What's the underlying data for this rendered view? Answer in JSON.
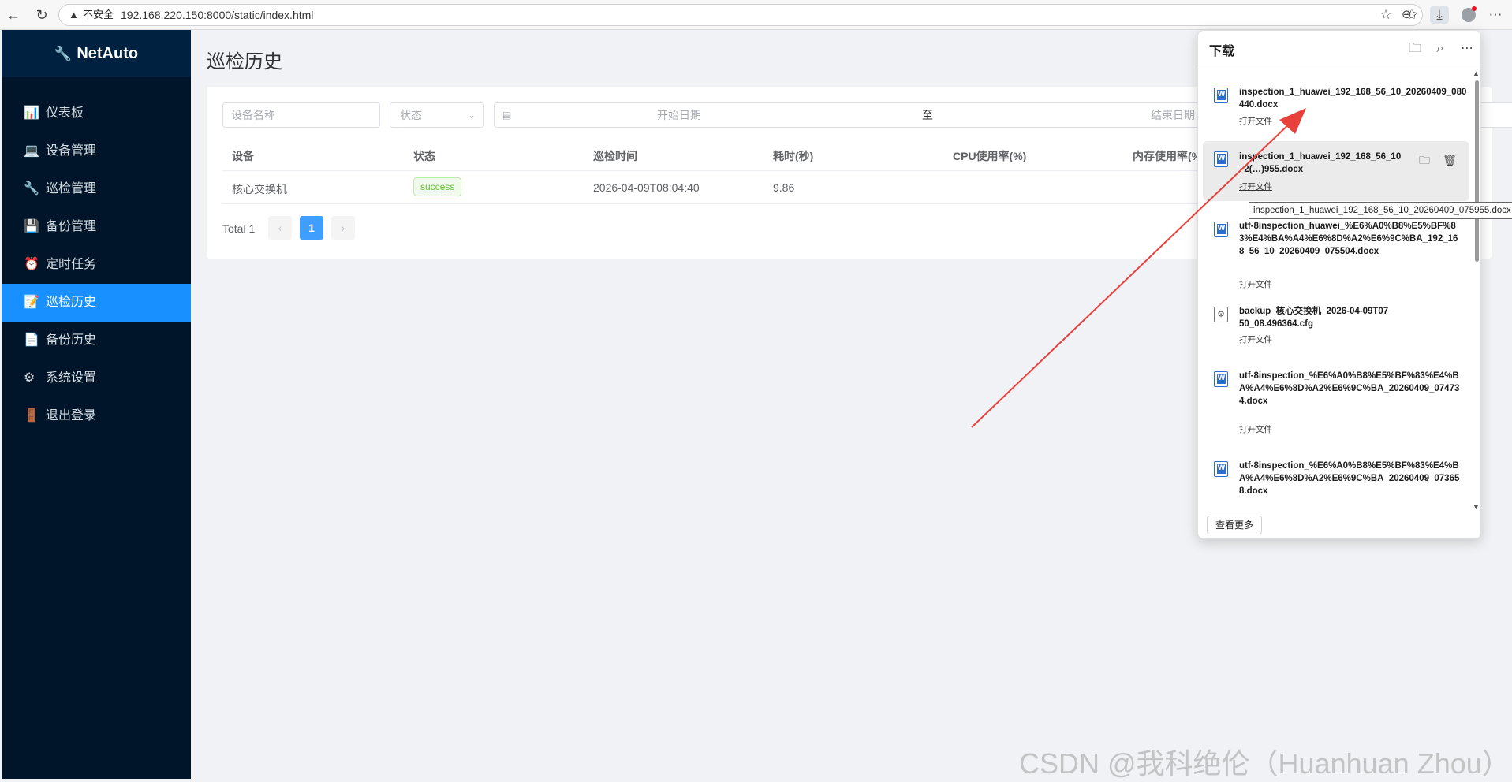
{
  "browser": {
    "insecure_label": "不安全",
    "url": "192.168.220.150:8000/static/index.html"
  },
  "sidebar": {
    "logo": "NetAuto",
    "items": [
      {
        "icon": "dashboard-icon",
        "glyph": "📊",
        "label": "仪表板"
      },
      {
        "icon": "device-icon",
        "glyph": "💻",
        "label": "设备管理"
      },
      {
        "icon": "wrench-icon",
        "glyph": "🔧",
        "label": "巡检管理"
      },
      {
        "icon": "floppy-icon",
        "glyph": "💾",
        "label": "备份管理"
      },
      {
        "icon": "alarm-clock-icon",
        "glyph": "⏰",
        "label": "定时任务"
      },
      {
        "icon": "notepad-icon",
        "glyph": "📝",
        "label": "巡检历史"
      },
      {
        "icon": "document-icon",
        "glyph": "📄",
        "label": "备份历史"
      },
      {
        "icon": "gear-icon",
        "glyph": "⚙",
        "label": "系统设置"
      },
      {
        "icon": "door-icon",
        "glyph": "🚪",
        "label": "退出登录"
      }
    ],
    "active_index": 5
  },
  "main": {
    "title": "巡检历史",
    "filters": {
      "device_placeholder": "设备名称",
      "status_placeholder": "状态",
      "start_placeholder": "开始日期",
      "separator": "至",
      "end_placeholder": "结束日期"
    },
    "table": {
      "columns": [
        "设备",
        "状态",
        "巡检时间",
        "耗时(秒)",
        "CPU使用率(%)",
        "内存使用率(%"
      ],
      "rows": [
        {
          "device": "核心交换机",
          "status": "success",
          "time": "2026-04-09T08:04:40",
          "duration": "9.86"
        }
      ]
    },
    "pagination": {
      "total": "Total 1",
      "current": "1",
      "prev": "‹",
      "next": "›"
    }
  },
  "downloads": {
    "title": "下载",
    "open_label": "打开文件",
    "see_more": "查看更多",
    "items": [
      {
        "name": "inspection_1_huawei_192_168_56_10_20260409_080440.docx"
      },
      {
        "name": "inspection_1_huawei_192_168_56_10_20260409_075955.docx",
        "visible_name": "inspection_1_huawei_192_168_56_10_2(…)955.docx"
      },
      {
        "name": "utf-8inspection_huawei_%E6%A0%B8%E5%BF%83%E4%BA%A4%E6%8D%A2%E6%9C%BA_192_168_56_10_20260409_075504.docx"
      },
      {
        "name": "backup_核心交换机_2026-04-09T07_50_08.496364.cfg"
      },
      {
        "name": "utf-8inspection_%E6%A0%B8%E5%BF%83%E4%BA%A4%E6%8D%A2%E6%9C%BA_20260409_074734.docx"
      },
      {
        "name": "utf-8inspection_%E6%A0%B8%E5%BF%83%E4%BA%A4%E6%8D%A2%E6%9C%BA_20260409_073658.docx"
      }
    ],
    "tooltip": "inspection_1_huawei_192_168_56_10_20260409_075955.docx"
  },
  "watermark": "CSDN @我科绝伦（Huanhuan Zhou）",
  "colors": {
    "sidebar_bg": "#001529",
    "active": "#1890ff",
    "success": "#67c23a",
    "arrow": "#e8413c"
  }
}
